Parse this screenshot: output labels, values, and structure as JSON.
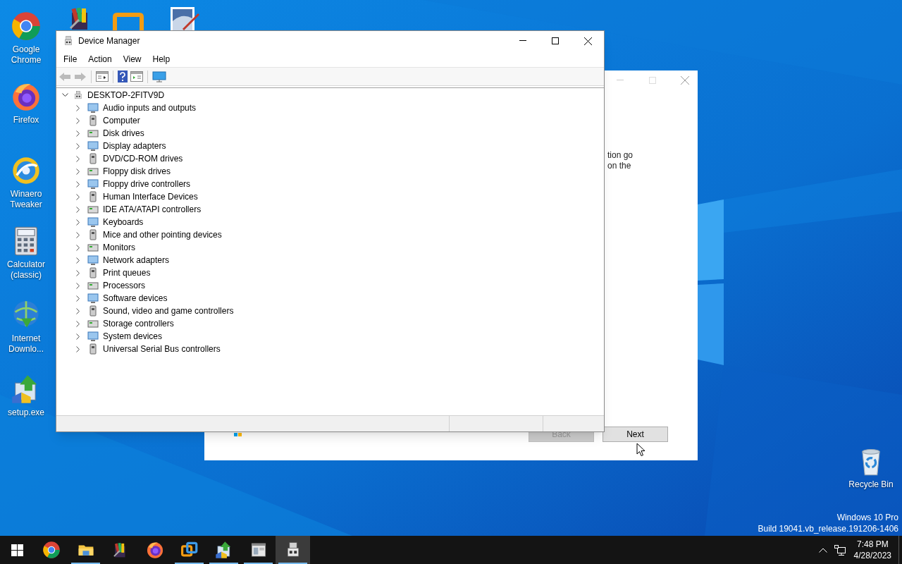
{
  "desktop_icons": [
    {
      "label": "Google Chrome",
      "kind": "chrome"
    },
    {
      "label": "Firefox",
      "kind": "firefox"
    },
    {
      "label": "Winaero Tweaker",
      "kind": "winaero"
    },
    {
      "label": "Calculator (classic)",
      "kind": "calculator"
    },
    {
      "label": "Internet Downlo...",
      "kind": "download"
    },
    {
      "label": "setup.exe",
      "kind": "setup"
    },
    {
      "label": "Recycle Bin",
      "kind": "recycle"
    }
  ],
  "setup_dialog": {
    "text_lines": [
      "tion go",
      "on the"
    ],
    "buttons": [
      {
        "label": "Back",
        "disabled": true
      },
      {
        "label": "Next",
        "disabled": false
      }
    ]
  },
  "device_manager": {
    "title": "Device Manager",
    "menu": [
      "File",
      "Action",
      "View",
      "Help"
    ],
    "tree": {
      "label": "DESKTOP-2FITV9D",
      "expanded": true,
      "children": [
        {
          "label": "Audio inputs and outputs",
          "expanded": false
        },
        {
          "label": "Computer",
          "expanded": false
        },
        {
          "label": "Disk drives",
          "expanded": false
        },
        {
          "label": "Display adapters",
          "expanded": false
        },
        {
          "label": "DVD/CD-ROM drives",
          "expanded": false
        },
        {
          "label": "Floppy disk drives",
          "expanded": false
        },
        {
          "label": "Floppy drive controllers",
          "expanded": false
        },
        {
          "label": "Human Interface Devices",
          "expanded": false
        },
        {
          "label": "IDE ATA/ATAPI controllers",
          "expanded": false
        },
        {
          "label": "Keyboards",
          "expanded": false
        },
        {
          "label": "Mice and other pointing devices",
          "expanded": false
        },
        {
          "label": "Monitors",
          "expanded": false
        },
        {
          "label": "Network adapters",
          "expanded": false
        },
        {
          "label": "Print queues",
          "expanded": false
        },
        {
          "label": "Processors",
          "expanded": false
        },
        {
          "label": "Software devices",
          "expanded": false
        },
        {
          "label": "Sound, video and game controllers",
          "expanded": false
        },
        {
          "label": "Storage controllers",
          "expanded": false
        },
        {
          "label": "System devices",
          "expanded": false
        },
        {
          "label": "Universal Serial Bus controllers",
          "expanded": false
        }
      ]
    }
  },
  "desktop_text": [
    "Windows 10 Pro",
    "Build 19041.vb_release.191206-1406"
  ],
  "taskbar": {
    "apps": [
      {
        "kind": "chrome",
        "running": false,
        "selected": false
      },
      {
        "kind": "folder",
        "running": true,
        "selected": false
      },
      {
        "kind": "archive",
        "running": false,
        "selected": false
      },
      {
        "kind": "firefox",
        "running": false,
        "selected": false
      },
      {
        "kind": "vm",
        "running": true,
        "selected": false
      },
      {
        "kind": "setup",
        "running": true,
        "selected": false
      },
      {
        "kind": "window",
        "running": true,
        "selected": false
      },
      {
        "kind": "device",
        "running": true,
        "selected": true
      }
    ],
    "time": "7:48 PM",
    "date": "4/28/2023"
  }
}
